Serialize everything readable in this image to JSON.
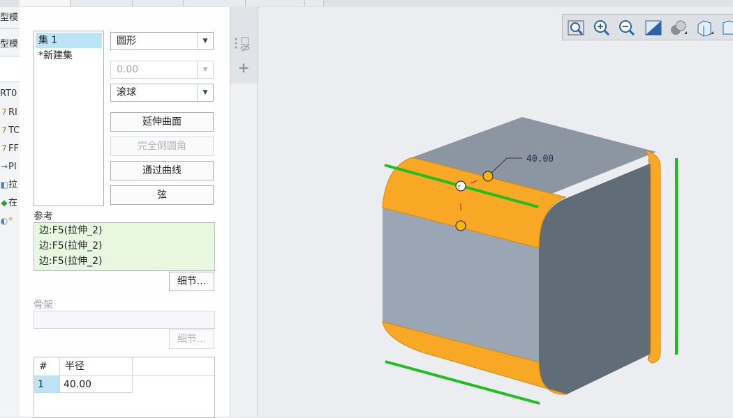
{
  "left_tree": {
    "items": [
      {
        "text": "型模",
        "icon": "model-icon"
      },
      {
        "text": "型模",
        "icon": "model-icon"
      },
      {
        "text": "RT0",
        "icon": "none"
      },
      {
        "text": "RI",
        "icon": "datum-plane-icon"
      },
      {
        "text": "TC",
        "icon": "datum-plane-icon"
      },
      {
        "text": "FF",
        "icon": "datum-plane-icon"
      },
      {
        "text": "PI",
        "icon": "coordinate-system-icon"
      },
      {
        "text": "拉",
        "icon": "extrude-icon"
      },
      {
        "text": "在",
        "icon": "insert-here-icon"
      },
      {
        "text": "*",
        "icon": "round-feature-icon"
      }
    ]
  },
  "sets": {
    "items": [
      "集 1",
      "*新建集"
    ],
    "selected_index": 0
  },
  "options": {
    "shape": "圆形",
    "value": "0.00",
    "method": "滚球"
  },
  "buttons": {
    "extend_surface": "延伸曲面",
    "full_round": "完全倒圆角",
    "through_curve": "通过曲线",
    "chord": "弦",
    "details": "细节...",
    "details_skeleton": "细节..."
  },
  "references": {
    "label": "参考",
    "items": [
      "边:F5(拉伸_2)",
      "边:F5(拉伸_2)",
      "边:F5(拉伸_2)"
    ]
  },
  "skeleton": {
    "label": "骨架"
  },
  "radius_table": {
    "headers": [
      "#",
      "半径"
    ],
    "rows": [
      {
        "index": "1",
        "radius": "40.00"
      }
    ]
  },
  "viewport": {
    "dimension_label": "40.00",
    "toolbar_icons": [
      "refit-icon",
      "zoom-in-icon",
      "zoom-out-icon",
      "repaint-icon",
      "display-style-icon",
      "saved-views-icon",
      "more-icon"
    ]
  },
  "colors": {
    "fillet": "#f9a825",
    "selected_edge": "#1fbf1f",
    "body_light": "#9aa6b3",
    "body_dark": "#606b78",
    "reference_bg": "#e8f7df",
    "selection": "#bde3f7"
  }
}
